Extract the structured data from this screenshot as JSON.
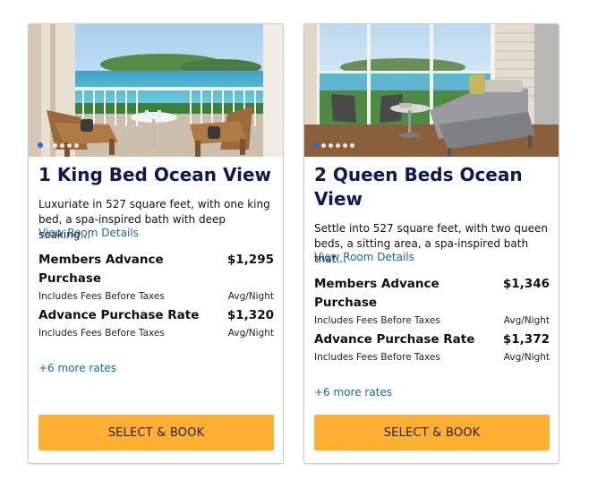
{
  "cards": [
    {
      "title": "1 King Bed Ocean View",
      "description": "Luxuriate in 527 square feet, with one king bed, a spa-inspired bath with deep soaking...",
      "details_link": "View Room Details",
      "photo_icon": "balcony-ocean-view-photo",
      "carousel": {
        "count": 6,
        "active": 1
      },
      "rates": [
        {
          "name": "Members Advance Purchase",
          "price": "$1,295",
          "fees": "Includes Fees Before Taxes",
          "unit": "Avg/Night"
        },
        {
          "name": "Advance Purchase Rate",
          "price": "$1,320",
          "fees": "Includes Fees Before Taxes",
          "unit": "Avg/Night"
        }
      ],
      "more_rates": "+6 more rates",
      "button": "SELECT & BOOK"
    },
    {
      "title": "2 Queen Beds Ocean View",
      "description": "Settle into 527 square feet, with two queen beds, a sitting area, a spa-inspired bath that...",
      "details_link": "View Room Details",
      "photo_icon": "room-lounge-balcony-photo",
      "carousel": {
        "count": 6,
        "active": 1
      },
      "rates": [
        {
          "name": "Members Advance Purchase",
          "price": "$1,346",
          "fees": "Includes Fees Before Taxes",
          "unit": "Avg/Night"
        },
        {
          "name": "Advance Purchase Rate",
          "price": "$1,372",
          "fees": "Includes Fees Before Taxes",
          "unit": "Avg/Night"
        }
      ],
      "more_rates": "+6 more rates",
      "button": "SELECT & BOOK"
    }
  ],
  "colors": {
    "title": "#0c1a4f",
    "link": "#1766b0",
    "button": "#ffb033",
    "carousel_active": "#1f6fd1"
  }
}
